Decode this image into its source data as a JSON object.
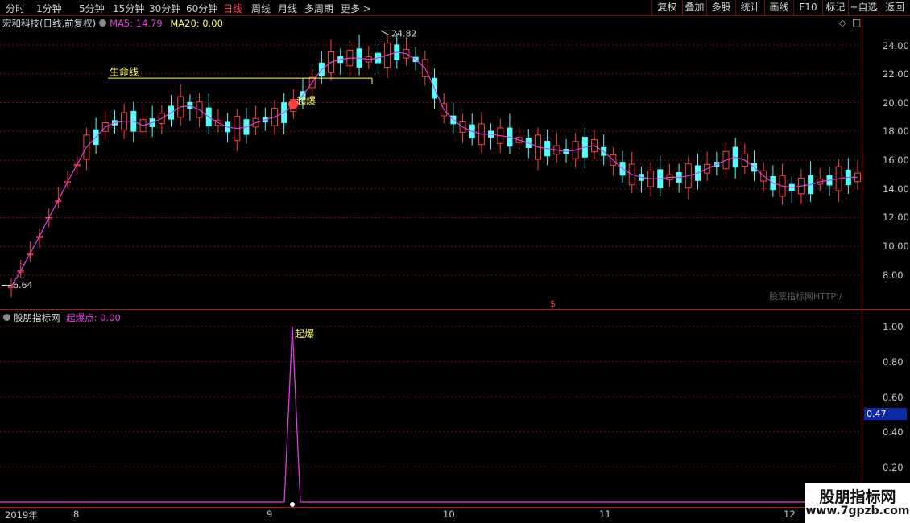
{
  "toolbar": {
    "periods": [
      "分时",
      "1分钟",
      "5分钟",
      "15分钟",
      "30分钟",
      "60分钟",
      "日线",
      "周线",
      "月线",
      "多周期",
      "更多 >"
    ],
    "active_period": "日线",
    "buttons": [
      "复权",
      "叠加",
      "多股",
      "统计",
      "画线",
      "F10",
      "标记",
      "+自选",
      "返回"
    ]
  },
  "info": {
    "stock": "宏和科技(日线,前复权)",
    "ma5_label": "MA5: 14.79",
    "ma20_label": "MA20: 0.00"
  },
  "main_annotations": {
    "shengming": "生命线",
    "qibao": "起爆",
    "high_price": "24.82",
    "low_price": "6.64",
    "dollar": "$"
  },
  "indicator": {
    "name": "股朋指标网",
    "label": "起爆点: 0.00",
    "spike_label": "起爆",
    "current_value": "0.47"
  },
  "watermark": "股票指标网HTTP:/",
  "logo": {
    "name": "股朋指标网",
    "url": "www.7gpzb.com"
  },
  "dates": [
    "2019年",
    "8",
    "9",
    "10",
    "11",
    "12"
  ],
  "colors": {
    "up": "#ff4040",
    "down": "#54ffff",
    "ma": "#e040e0",
    "grid": "#7a1010",
    "life_line": "#ffff60"
  },
  "chart_data": [
    {
      "type": "candlestick",
      "ylim": [
        6.64,
        25.6
      ],
      "yticks": [
        8.0,
        10.0,
        12.0,
        14.0,
        16.0,
        18.0,
        20.0,
        22.0,
        24.0
      ],
      "series": [
        {
          "name": "MA5",
          "values": [
            7.2,
            8.3,
            9.5,
            10.7,
            12.0,
            13.2,
            14.5,
            15.7,
            16.9,
            17.6,
            18.3,
            18.6,
            18.7,
            18.7,
            18.4,
            18.6,
            18.9,
            19.3,
            19.7,
            19.8,
            19.5,
            19.0,
            18.6,
            18.3,
            18.2,
            18.3,
            18.6,
            18.8,
            19.0,
            19.3,
            19.8,
            20.5,
            21.4,
            22.3,
            22.8,
            23.0,
            23.1,
            23.1,
            23.0,
            23.1,
            23.3,
            23.5,
            23.4,
            23.0,
            22.4,
            21.0,
            19.5,
            18.8,
            18.3,
            18.0,
            17.8,
            17.8,
            17.7,
            17.6,
            17.4,
            17.2,
            16.9,
            16.8,
            16.7,
            16.6,
            16.7,
            16.9,
            17.0,
            16.6,
            16.0,
            15.4,
            15.0,
            14.8,
            14.7,
            14.7,
            14.8,
            14.8,
            14.9,
            15.1,
            15.4,
            15.7,
            16.0,
            16.2,
            16.0,
            15.5,
            14.9,
            14.4,
            14.2,
            14.1,
            14.2,
            14.3,
            14.5,
            14.6,
            14.7,
            14.8,
            14.8
          ]
        }
      ]
    },
    {
      "type": "line",
      "title": "起爆点",
      "yticks": [
        0.2,
        0.4,
        0.6,
        0.8,
        1.0
      ],
      "x": [
        "2019年",
        "8",
        "9",
        "10",
        "11",
        "12"
      ],
      "spike": {
        "value": 1.0,
        "baseline": 0.0
      }
    }
  ]
}
